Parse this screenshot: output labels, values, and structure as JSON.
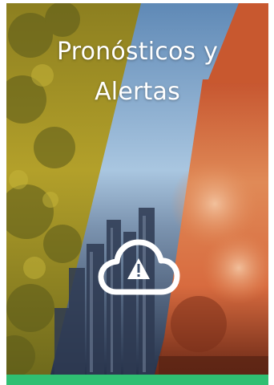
{
  "card": {
    "title_line1": "Pronósticos y",
    "title_line2": "Alertas",
    "icon": "cloud-warning-icon"
  },
  "colors": {
    "accent_bar": "#2fbf72",
    "title_text": "#ffffff",
    "forest_tint": "#a99a1e",
    "sky_blue": "#8ab4d8",
    "city_blue": "#3c4f6e",
    "fire_orange": "#d8643a"
  }
}
